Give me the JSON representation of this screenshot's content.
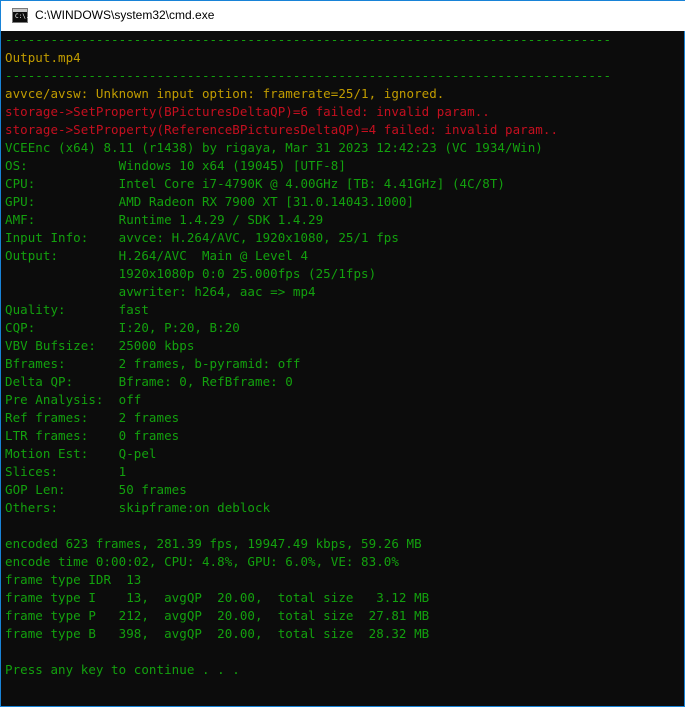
{
  "window": {
    "title": "C:\\WINDOWS\\system32\\cmd.exe",
    "icon_label": "C:\\."
  },
  "colors": {
    "default": "#13a10e",
    "warning": "#c19c00",
    "error": "#c50f1f"
  },
  "console": {
    "lines": [
      {
        "text": "--------------------------------------------------------------------------------",
        "color": "green"
      },
      {
        "text": "Output.mp4",
        "color": "yellow"
      },
      {
        "text": "--------------------------------------------------------------------------------",
        "color": "green"
      },
      {
        "text": "avvce/avsw: Unknown input option: framerate=25/1, ignored.",
        "color": "yellow"
      },
      {
        "text": "storage->SetProperty(BPicturesDeltaQP)=6 failed: invalid param..",
        "color": "red"
      },
      {
        "text": "storage->SetProperty(ReferenceBPicturesDeltaQP)=4 failed: invalid param..",
        "color": "red"
      },
      {
        "text": "VCEEnc (x64) 8.11 (r1438) by rigaya, Mar 31 2023 12:42:23 (VC 1934/Win)",
        "color": "green"
      },
      {
        "text": "OS:            Windows 10 x64 (19045) [UTF-8]",
        "color": "green"
      },
      {
        "text": "CPU:           Intel Core i7-4790K @ 4.00GHz [TB: 4.41GHz] (4C/8T)",
        "color": "green"
      },
      {
        "text": "GPU:           AMD Radeon RX 7900 XT [31.0.14043.1000]",
        "color": "green"
      },
      {
        "text": "AMF:           Runtime 1.4.29 / SDK 1.4.29",
        "color": "green"
      },
      {
        "text": "Input Info:    avvce: H.264/AVC, 1920x1080, 25/1 fps",
        "color": "green"
      },
      {
        "text": "Output:        H.264/AVC  Main @ Level 4",
        "color": "green"
      },
      {
        "text": "               1920x1080p 0:0 25.000fps (25/1fps)",
        "color": "green"
      },
      {
        "text": "               avwriter: h264, aac => mp4",
        "color": "green"
      },
      {
        "text": "Quality:       fast",
        "color": "green"
      },
      {
        "text": "CQP:           I:20, P:20, B:20",
        "color": "green"
      },
      {
        "text": "VBV Bufsize:   25000 kbps",
        "color": "green"
      },
      {
        "text": "Bframes:       2 frames, b-pyramid: off",
        "color": "green"
      },
      {
        "text": "Delta QP:      Bframe: 0, RefBframe: 0",
        "color": "green"
      },
      {
        "text": "Pre Analysis:  off",
        "color": "green"
      },
      {
        "text": "Ref frames:    2 frames",
        "color": "green"
      },
      {
        "text": "LTR frames:    0 frames",
        "color": "green"
      },
      {
        "text": "Motion Est:    Q-pel",
        "color": "green"
      },
      {
        "text": "Slices:        1",
        "color": "green"
      },
      {
        "text": "GOP Len:       50 frames",
        "color": "green"
      },
      {
        "text": "Others:        skipframe:on deblock",
        "color": "green"
      },
      {
        "text": "",
        "color": "green"
      },
      {
        "text": "encoded 623 frames, 281.39 fps, 19947.49 kbps, 59.26 MB",
        "color": "green"
      },
      {
        "text": "encode time 0:00:02, CPU: 4.8%, GPU: 6.0%, VE: 83.0%",
        "color": "green"
      },
      {
        "text": "frame type IDR  13",
        "color": "green"
      },
      {
        "text": "frame type I    13,  avgQP  20.00,  total size   3.12 MB",
        "color": "green"
      },
      {
        "text": "frame type P   212,  avgQP  20.00,  total size  27.81 MB",
        "color": "green"
      },
      {
        "text": "frame type B   398,  avgQP  20.00,  total size  28.32 MB",
        "color": "green"
      },
      {
        "text": "",
        "color": "green"
      },
      {
        "text": "Press any key to continue . . .",
        "color": "green"
      }
    ]
  }
}
